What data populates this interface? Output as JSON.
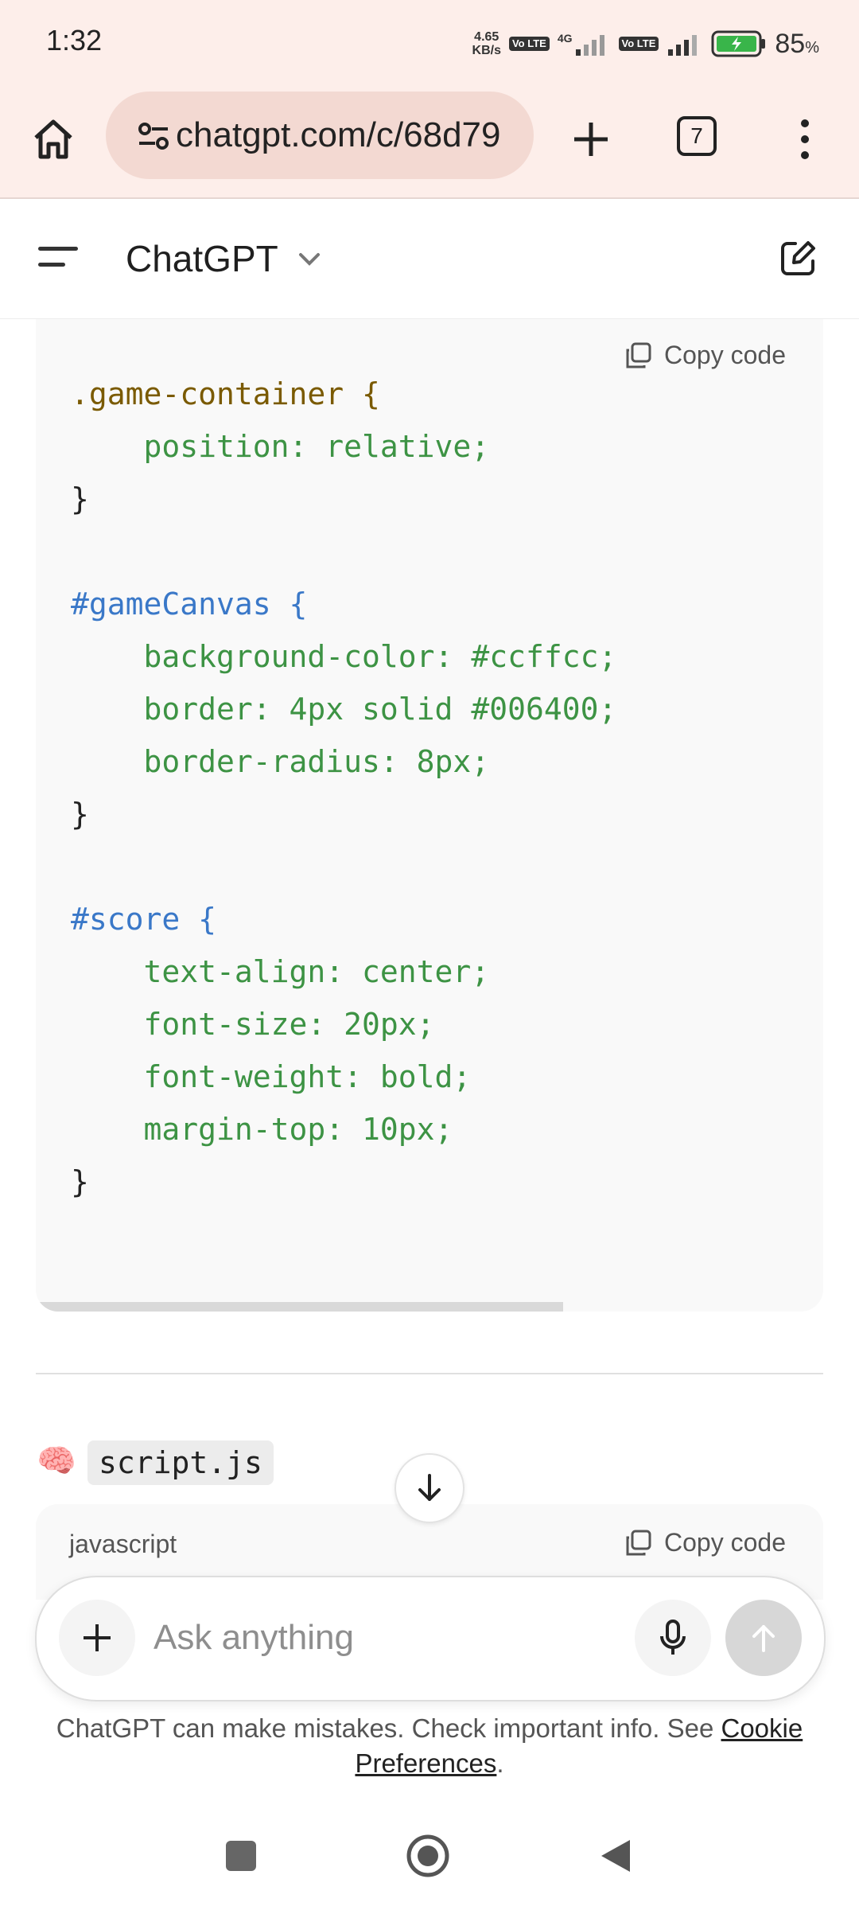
{
  "status_bar": {
    "time": "1:32",
    "net_speed_value": "4.65",
    "net_speed_unit": "KB/s",
    "volte": "Vo LTE",
    "signal_label": "4G",
    "battery": "85",
    "battery_unit": "%"
  },
  "browser": {
    "url": "chatgpt.com/c/68d79",
    "tab_count": "7",
    "icons": [
      "home-icon",
      "site-settings-icon",
      "plus-icon",
      "tabs-icon",
      "more-vert-icon"
    ]
  },
  "app_header": {
    "title": "ChatGPT",
    "icons": [
      "sidebar-menu-icon",
      "chevron-down-icon",
      "new-chat-icon"
    ]
  },
  "code_block": {
    "copy_label": "Copy code",
    "lines": [
      "}",
      "",
      ".game-container {",
      "    position: relative;",
      "}",
      "",
      "#gameCanvas {",
      "    background-color: #ccffcc;",
      "    border: 4px solid #006400;",
      "    border-radius: 8px;",
      "}",
      "",
      "#score {",
      "    text-align: center;",
      "    font-size: 20px;",
      "    font-weight: bold;",
      "    margin-top: 10px;",
      "}"
    ],
    "horizontal_scroll_fraction": 0.67
  },
  "next_section": {
    "emoji": "🧠",
    "filename": "script.js",
    "language": "javascript",
    "copy_label": "Copy code"
  },
  "composer": {
    "placeholder": "Ask anything",
    "icons": [
      "plus-icon",
      "microphone-icon",
      "send-arrow-icon"
    ]
  },
  "disclaimer": {
    "text": "ChatGPT can make mistakes. Check important info. See ",
    "link": "Cookie Preferences",
    "end": "."
  },
  "nav_bar": {
    "icons": [
      "recent-apps-icon",
      "home-circle-icon",
      "back-icon"
    ]
  },
  "colors": {
    "status_bg": "#fdeeea",
    "url_pill": "#f3d9d2",
    "code_bg": "#f9f9f9",
    "css_property": "#3d9344",
    "css_value": "#8a6400",
    "css_id": "#3a78c8"
  }
}
